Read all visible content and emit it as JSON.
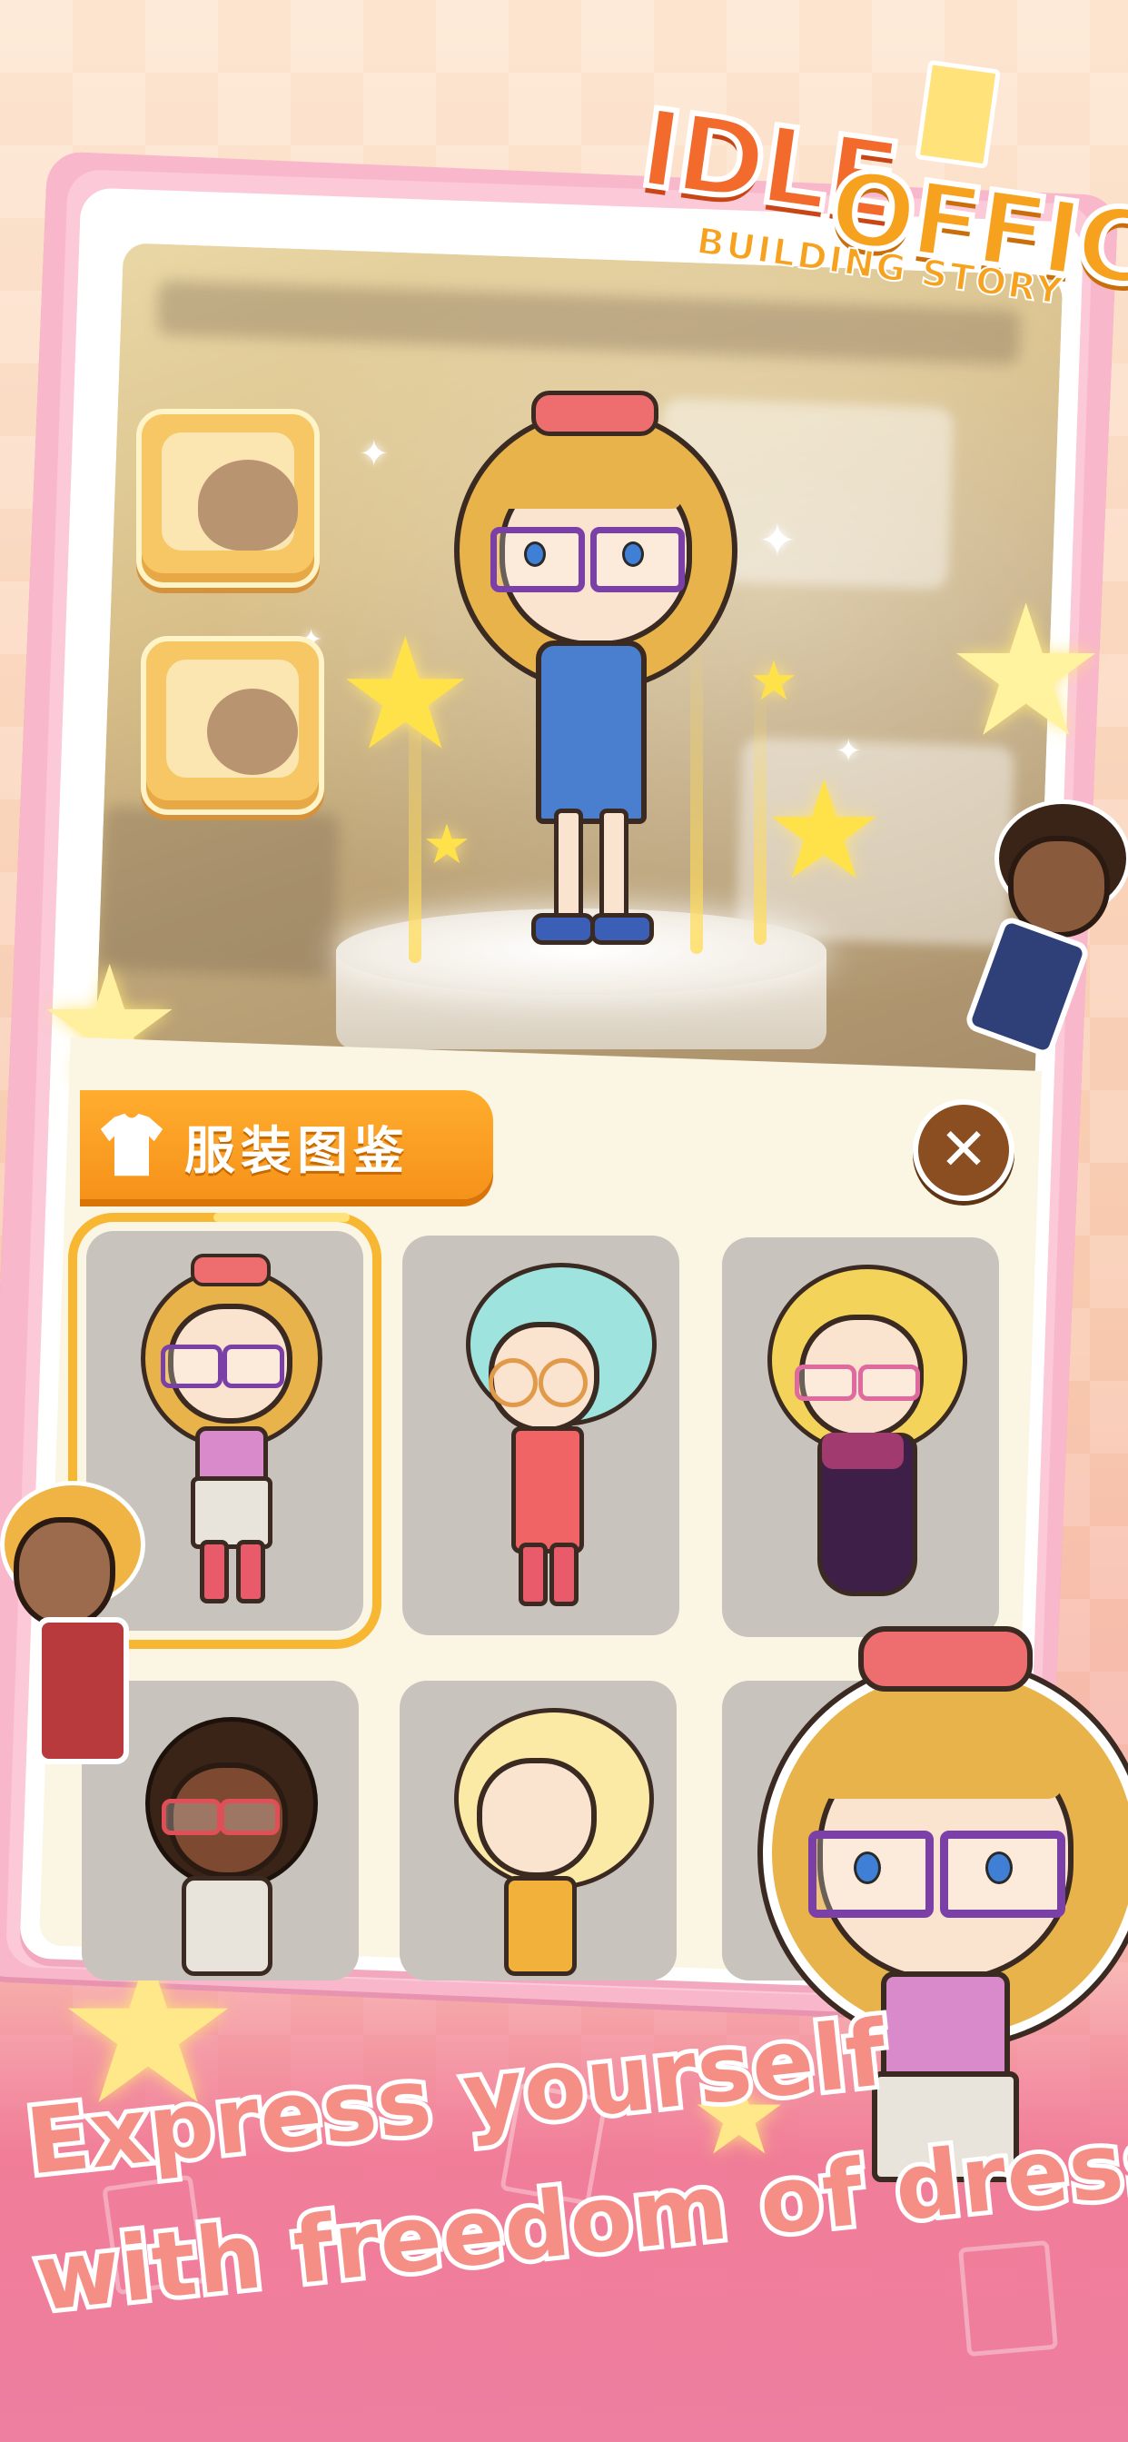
{
  "logo": {
    "title_word1": "IDLE",
    "title_word2": "OFFICE",
    "subtitle": "BUILDING STORY"
  },
  "wardrobe": {
    "tab_title": "服装图鉴",
    "tab_icon": "shirt-icon",
    "close_icon": "close-icon",
    "slots": [
      {
        "icon": "hair-silhouette-icon"
      },
      {
        "icon": "face-silhouette-icon"
      }
    ],
    "outfits": [
      {
        "name": "outfit-1",
        "selected": true
      },
      {
        "name": "outfit-2",
        "selected": false
      },
      {
        "name": "outfit-3",
        "selected": false
      },
      {
        "name": "outfit-4",
        "selected": false
      },
      {
        "name": "outfit-5",
        "selected": false
      },
      {
        "name": "outfit-6",
        "selected": false
      }
    ]
  },
  "tagline": {
    "line1": "Express yourself",
    "line2": "with freedom of dress-up"
  },
  "colors": {
    "accent_orange": "#f6921a",
    "close_brown": "#8a4e21",
    "tagline_pink": "#f58f86",
    "star_yellow": "#ffe14a"
  }
}
